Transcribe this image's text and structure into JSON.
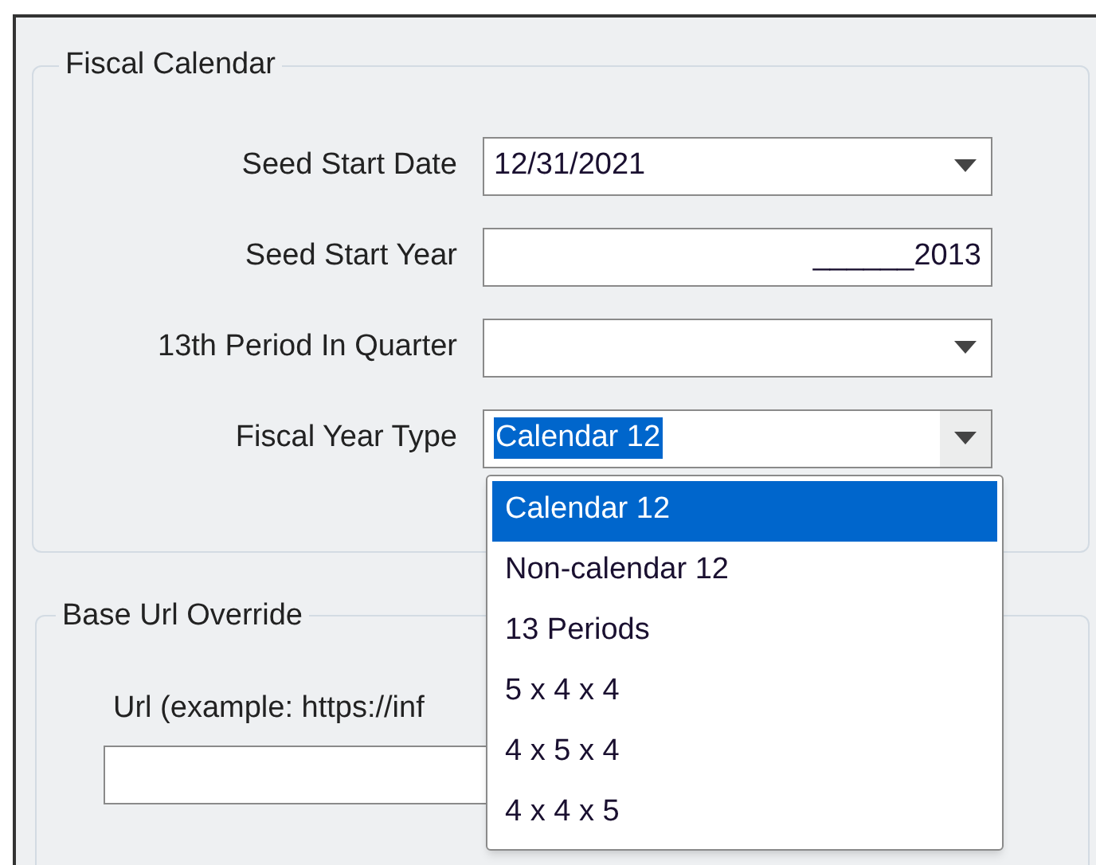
{
  "sections": [
    {
      "title": "Fiscal Calendar",
      "fields": [
        {
          "label": "Seed Start Date",
          "kind": "dropdown",
          "value": "12/31/2021",
          "open": false
        },
        {
          "label": "Seed Start Year",
          "kind": "text",
          "value": "______2013"
        },
        {
          "label": "13th Period In Quarter",
          "kind": "dropdown",
          "open": false
        },
        {
          "label": "Fiscal Year Type",
          "kind": "dropdown",
          "value": "Calendar 12",
          "open": true,
          "options": [
            {
              "label": "Calendar 12",
              "selected": true
            },
            {
              "label": "Non-calendar 12",
              "selected": false
            },
            {
              "label": "13 Periods",
              "selected": false
            },
            {
              "label": "5 x 4 x 4",
              "selected": false
            },
            {
              "label": "4 x 5 x 4",
              "selected": false
            },
            {
              "label": "4 x 4 x 5",
              "selected": false
            }
          ]
        }
      ]
    },
    {
      "title": "Base Url Override",
      "fields": [
        {
          "label": "Url (example: https://inf",
          "kind": "url"
        }
      ]
    }
  ]
}
